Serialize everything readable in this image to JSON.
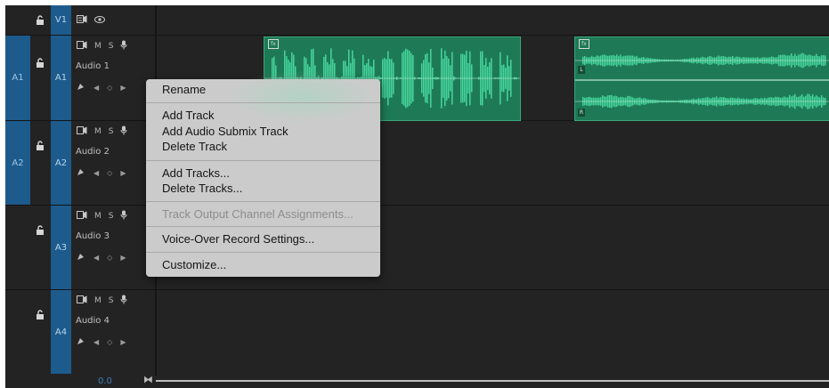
{
  "video_track": {
    "source": "",
    "target": "V1"
  },
  "audio_tracks": [
    {
      "source": "A1",
      "target": "A1",
      "name": "Audio 1",
      "mute": "M",
      "solo": "S"
    },
    {
      "source": "A2",
      "target": "A2",
      "name": "Audio 2",
      "mute": "M",
      "solo": "S"
    },
    {
      "source": "",
      "target": "A3",
      "name": "Audio 3",
      "mute": "M",
      "solo": "S"
    },
    {
      "source": "",
      "target": "A4",
      "name": "Audio 4",
      "mute": "M",
      "solo": "S"
    }
  ],
  "clips": [
    {
      "fx": "fx"
    },
    {
      "fx": "fx",
      "left_channel": "L",
      "right_channel": "R"
    }
  ],
  "timeline_footer": {
    "value": "0.0"
  },
  "context_menu": {
    "rename": "Rename",
    "add_track": "Add Track",
    "add_audio_submix_track": "Add Audio Submix Track",
    "delete_track": "Delete Track",
    "add_tracks": "Add Tracks...",
    "delete_tracks": "Delete Tracks...",
    "track_output_channel_assignments": "Track Output Channel Assignments...",
    "voice_over_record_settings": "Voice-Over Record Settings...",
    "customize": "Customize..."
  },
  "colors": {
    "panel": "#232323",
    "targeted": "#1d5b8c",
    "clip": "#1e7a56",
    "waveform": "#45d49b",
    "menu": "#cbcbcb"
  }
}
